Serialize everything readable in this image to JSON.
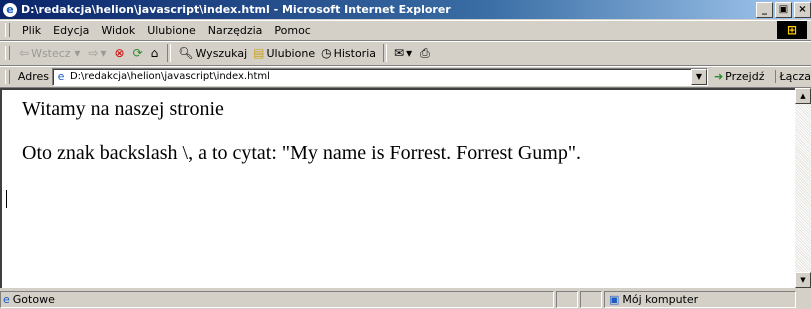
{
  "window": {
    "title": "D:\\redakcja\\helion\\javascript\\index.html - Microsoft Internet Explorer",
    "app_icon": "ie-icon",
    "buttons": [
      "_",
      "Ƶ",
      "X"
    ]
  },
  "menu": [
    "Plik",
    "Edycja",
    "Widok",
    "Ulubione",
    "Narzędzia",
    "Pomoc"
  ],
  "toolbar": {
    "back_label": "Wstecz",
    "search_label": "Wyszukaj",
    "favorites_label": "Ulubione",
    "history_label": "Historia"
  },
  "address": {
    "label": "Adres",
    "value": "D:\\redakcja\\helion\\javascript\\index.html",
    "go_label": "Przejdź",
    "links_label": "Łącza"
  },
  "content": {
    "line1": "Witamy na naszej stronie",
    "line2": "Oto znak backslash \\, a to cytat: \"My name is Forrest. Forrest Gump\"."
  },
  "status": {
    "text": "Gotowe",
    "zone": "Mój komputer"
  }
}
